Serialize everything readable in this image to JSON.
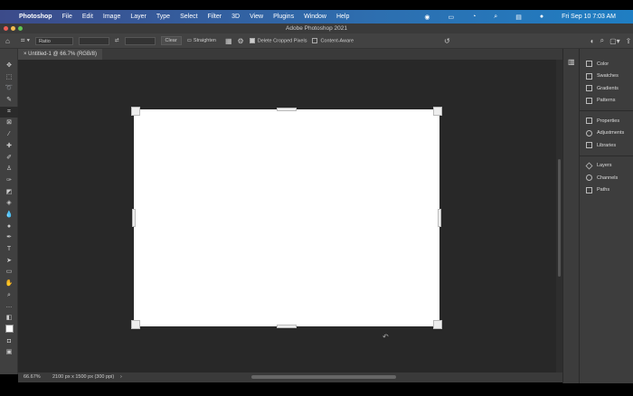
{
  "menubar": {
    "apple": "",
    "app": "Photoshop",
    "items": [
      "File",
      "Edit",
      "Image",
      "Layer",
      "Type",
      "Select",
      "Filter",
      "3D",
      "View",
      "Plugins",
      "Window",
      "Help"
    ],
    "clock": "Fri Sep 10  7:03 AM"
  },
  "window": {
    "title": "Adobe Photoshop 2021"
  },
  "options": {
    "ratio": "Ratio",
    "clear": "Clear",
    "straighten": "Straighten",
    "delete_cropped": "Delete Cropped Pixels",
    "content_aware": "Content-Aware"
  },
  "document": {
    "tab": "Untitled-1 @ 66.7% (RGB/8)"
  },
  "panels": {
    "group1": [
      "Color",
      "Swatches",
      "Gradients",
      "Patterns"
    ],
    "group2": [
      "Properties",
      "Adjustments",
      "Libraries"
    ],
    "group3": [
      "Layers",
      "Channels",
      "Paths"
    ]
  },
  "status": {
    "zoom": "66.67%",
    "size": "2100 px x 1500 px (300 ppi)",
    "arrow": "›"
  }
}
